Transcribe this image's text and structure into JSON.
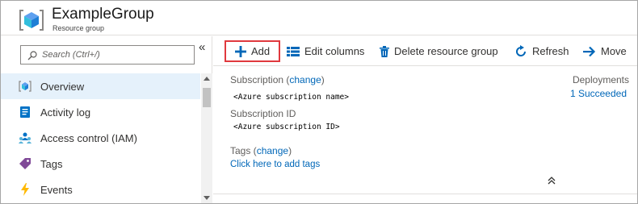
{
  "header": {
    "title": "ExampleGroup",
    "subtitle": "Resource group"
  },
  "sidebar": {
    "collapse_glyph": "«",
    "search": {
      "placeholder": "Search (Ctrl+/)",
      "value": ""
    },
    "items": [
      {
        "label": "Overview",
        "icon": "cube-icon",
        "active": true
      },
      {
        "label": "Activity log",
        "icon": "activity-log-icon"
      },
      {
        "label": "Access control (IAM)",
        "icon": "people-icon"
      },
      {
        "label": "Tags",
        "icon": "tag-icon"
      },
      {
        "label": "Events",
        "icon": "lightning-icon"
      }
    ]
  },
  "toolbar": {
    "add": "Add",
    "edit_columns": "Edit columns",
    "delete": "Delete resource group",
    "refresh": "Refresh",
    "move": "Move"
  },
  "essentials": {
    "subscription_label": "Subscription (",
    "subscription_change": "change",
    "subscription_close": ")",
    "subscription_name": "<Azure subscription name>",
    "subscription_id_label": "Subscription ID",
    "subscription_id": "<Azure subscription ID>",
    "tags_label": "Tags (",
    "tags_change": "change",
    "tags_close": ")",
    "tags_add": "Click here to add tags",
    "deployments_label": "Deployments",
    "deployments_value": "1 Succeeded"
  },
  "colors": {
    "accent": "#0067b8",
    "highlight_border": "#e0393e",
    "active_item_bg": "#e5f1fb"
  }
}
